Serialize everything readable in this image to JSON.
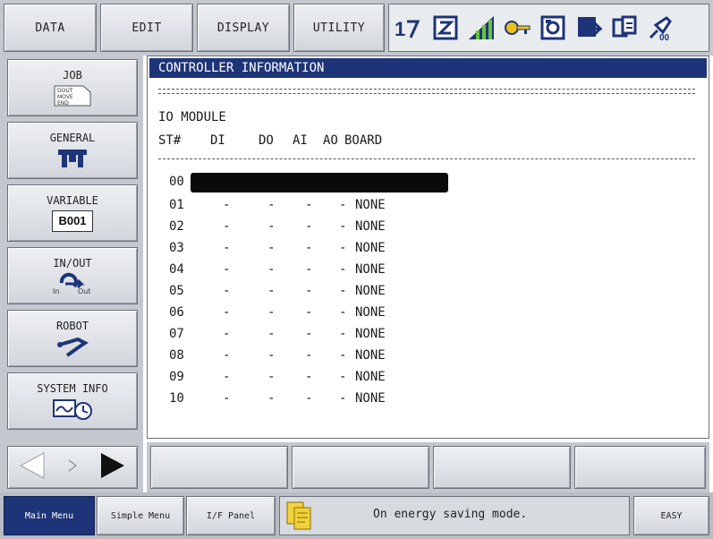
{
  "top_menu": {
    "data": "DATA",
    "edit": "EDIT",
    "display": "DISPLAY",
    "utility": "UTILITY"
  },
  "status_icons": [
    "step-icon",
    "edit-mode-icon",
    "signal-icon",
    "key-icon",
    "memory-icon",
    "cycle-icon",
    "transfer-icon",
    "tool-icon"
  ],
  "sidebar": {
    "items": [
      {
        "label": "JOB",
        "icon": "job-icon",
        "icon_text": [
          "DOUT",
          "MOVE",
          "END"
        ]
      },
      {
        "label": "GENERAL",
        "icon": "gripper-icon"
      },
      {
        "label": "VARIABLE",
        "icon": "variable-icon",
        "icon_text": "B001"
      },
      {
        "label": "IN/OUT",
        "icon": "in-out-icon",
        "icon_text_in": "In",
        "icon_text_out": "Out"
      },
      {
        "label": "ROBOT",
        "icon": "robot-arm-icon"
      },
      {
        "label": "SYSTEM INFO",
        "icon": "system-info-icon"
      }
    ]
  },
  "main": {
    "title": "CONTROLLER INFORMATION",
    "section": "IO MODULE",
    "headers": [
      "ST#",
      "DI",
      "DO",
      "AI",
      "AO",
      "BOARD"
    ],
    "rows": [
      {
        "st": "01",
        "di": "-",
        "do": "-",
        "ai": "-",
        "ao": "-",
        "board": "NONE"
      },
      {
        "st": "02",
        "di": "-",
        "do": "-",
        "ai": "-",
        "ao": "-",
        "board": "NONE"
      },
      {
        "st": "03",
        "di": "-",
        "do": "-",
        "ai": "-",
        "ao": "-",
        "board": "NONE"
      },
      {
        "st": "04",
        "di": "-",
        "do": "-",
        "ai": "-",
        "ao": "-",
        "board": "NONE"
      },
      {
        "st": "05",
        "di": "-",
        "do": "-",
        "ai": "-",
        "ao": "-",
        "board": "NONE"
      },
      {
        "st": "06",
        "di": "-",
        "do": "-",
        "ai": "-",
        "ao": "-",
        "board": "NONE"
      },
      {
        "st": "07",
        "di": "-",
        "do": "-",
        "ai": "-",
        "ao": "-",
        "board": "NONE"
      },
      {
        "st": "08",
        "di": "-",
        "do": "-",
        "ai": "-",
        "ao": "-",
        "board": "NONE"
      },
      {
        "st": "09",
        "di": "-",
        "do": "-",
        "ai": "-",
        "ao": "-",
        "board": "NONE"
      },
      {
        "st": "10",
        "di": "-",
        "do": "-",
        "ai": "-",
        "ao": "-",
        "board": "NONE"
      }
    ],
    "row00_st": "00"
  },
  "statusbar": {
    "main_menu": "Main Menu",
    "simple_menu": "Simple Menu",
    "if_panel": "I/F Panel",
    "message": "On energy saving mode.",
    "easy": "EASY"
  },
  "colors": {
    "title_bar": "#1e3478",
    "main_menu_active": "#1e3478",
    "panel_bg": "#c3c8cf"
  }
}
